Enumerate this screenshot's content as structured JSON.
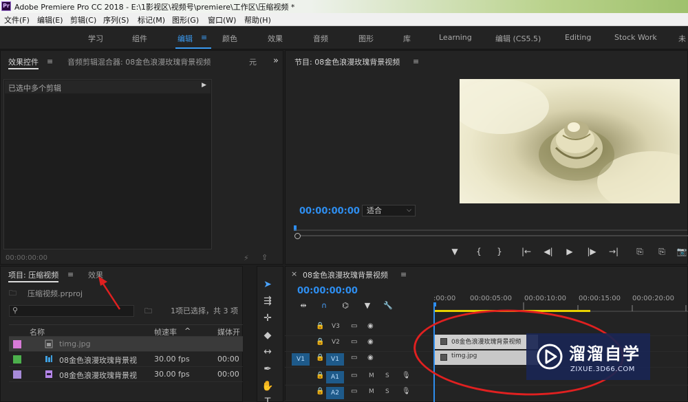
{
  "window": {
    "logo_text": "Pr",
    "title": "Adobe Premiere Pro CC 2018 - E:\\1影视区\\视频号\\premiere\\工作区\\压缩视频 *"
  },
  "menu": [
    "文件(F)",
    "编辑(E)",
    "剪辑(C)",
    "序列(S)",
    "标记(M)",
    "图形(G)",
    "窗口(W)",
    "帮助(H)"
  ],
  "workspaces": {
    "items": [
      "学习",
      "组件",
      "编辑",
      "颜色",
      "效果",
      "音频",
      "图形",
      "库",
      "Learning",
      "编辑 (CS5.5)",
      "Editing",
      "Stock Work",
      "未"
    ],
    "active_index": 2,
    "menu_glyph": "≡"
  },
  "effect_controls": {
    "tab_effect": "效果控件",
    "tab_mixer": "音频剪辑混合器: 08金色浪漫玫瑰背景视频",
    "tab_meta": "元",
    "overflow": "»",
    "selection_text": "已选中多个剪辑",
    "timecode": "00:00:00:00"
  },
  "program_monitor": {
    "title": "节目: 08金色浪漫玫瑰背景视频",
    "timecode": "00:00:00:00",
    "fit_label": "适合",
    "transport": [
      "▼",
      "{",
      "}",
      "|←",
      "◀|",
      "▶",
      "|▶",
      "→|",
      "⎘",
      "⎘",
      "📷"
    ]
  },
  "project": {
    "tab_project": "项目: 压缩视频",
    "tab_effects": "效果",
    "file_name": "压缩视频.prproj",
    "selection_info": "1项已选择，共 3 项",
    "columns": [
      "名称",
      "帧速率",
      "媒体开"
    ],
    "rows": [
      {
        "name": "timg.jpg",
        "fps": "",
        "start": "",
        "color": "#d77ad7"
      },
      {
        "name": "08金色浪漫玫瑰背景视",
        "fps": "30.00 fps",
        "start": "00:00",
        "color": "#4cb04c"
      },
      {
        "name": "08金色浪漫玫瑰背景视",
        "fps": "30.00 fps",
        "start": "00:00",
        "color": "#a78bd9"
      }
    ]
  },
  "timeline": {
    "close": "×",
    "title": "08金色浪漫玫瑰背景视频",
    "timecode": "00:00:00:00",
    "ticks": [
      ":00:00",
      "00:00:05:00",
      "00:00:10:00",
      "00:00:15:00",
      "00:00:20:00"
    ],
    "tracks": {
      "v3": "V3",
      "v2": "V2",
      "v1": "V1",
      "v1_target": "V1",
      "a1": "A1",
      "a2": "A2",
      "mute": "M",
      "solo": "S"
    },
    "clip_video": "08金色浪漫玫瑰背景视频",
    "clip_image": "timg.jpg"
  },
  "watermark": {
    "title": "溜溜自学",
    "subtitle": "ZIXUE.3D66.COM"
  },
  "colors": {
    "accent_blue": "#2e8ef0",
    "annotation_red": "#e02020"
  }
}
